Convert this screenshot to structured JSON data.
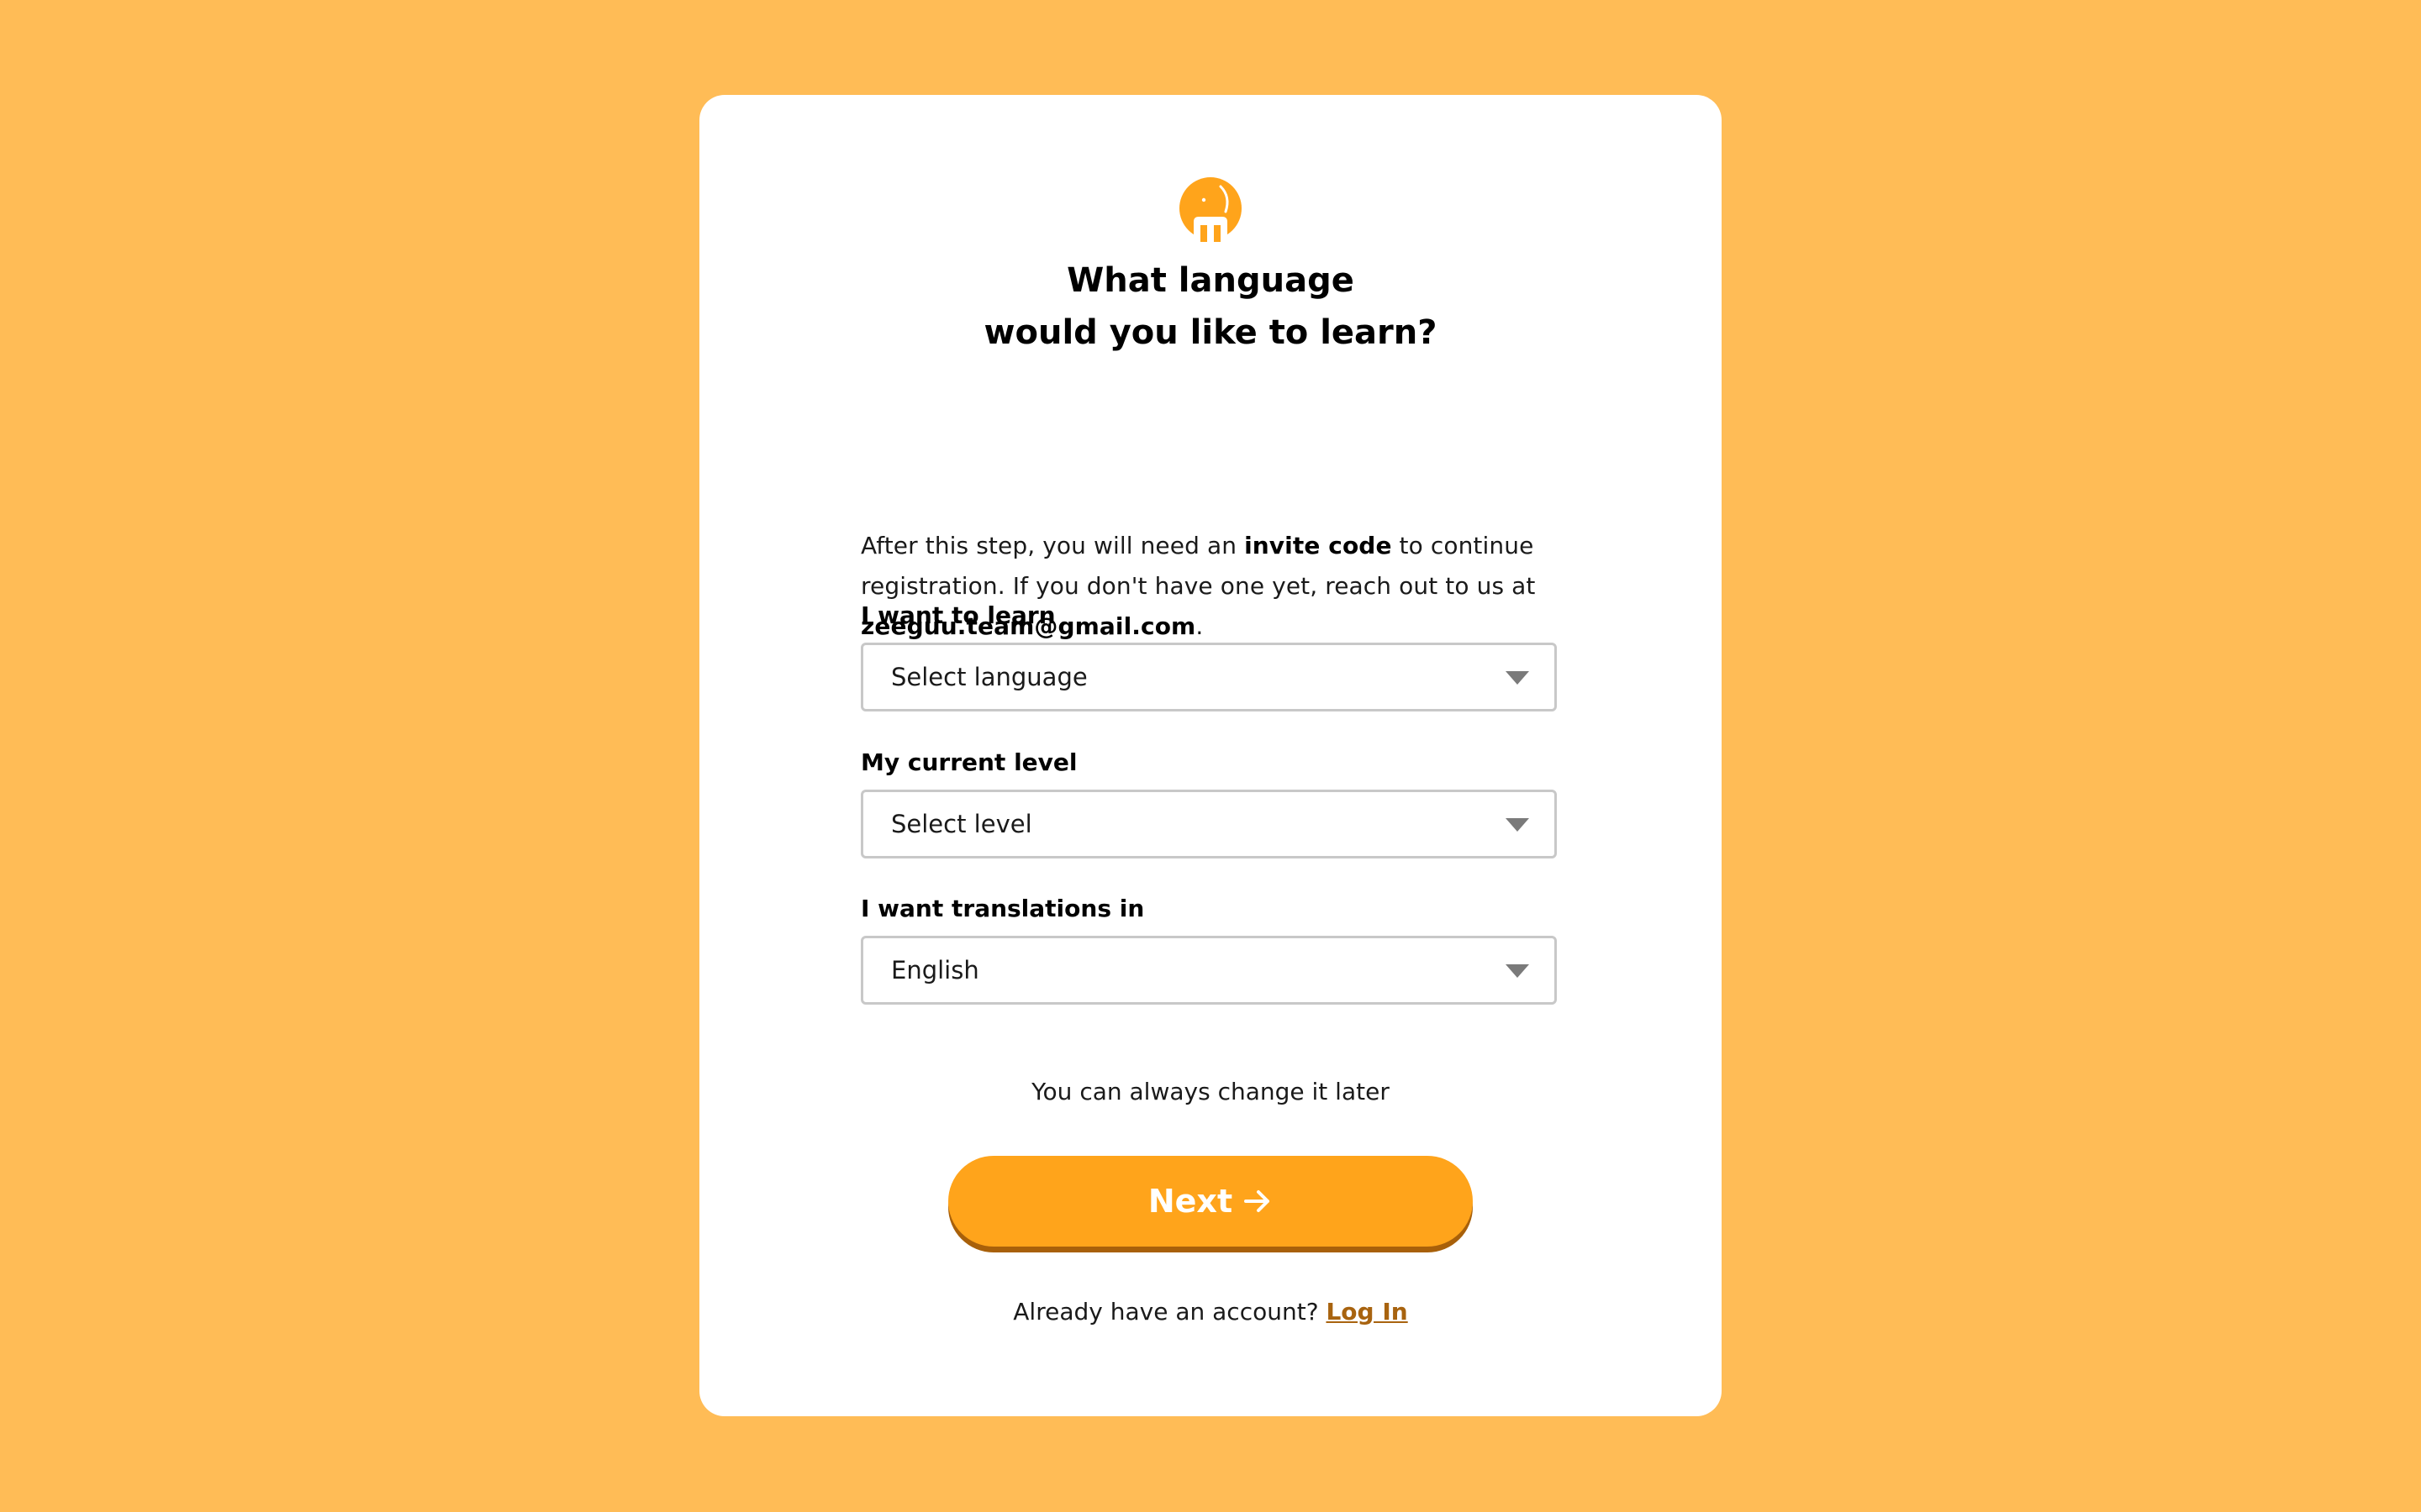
{
  "colors": {
    "background": "#FFBC56",
    "accent": "#FFA41B",
    "accent_shadow": "#A8600A",
    "link": "#A8630F"
  },
  "logo": {
    "icon": "elephant-icon"
  },
  "heading": {
    "line1": "What language",
    "line2": "would you like to learn?"
  },
  "intro": {
    "part1": "After this step, you will need an ",
    "bold1": "invite code",
    "part2": " to continue registration. If you don't have one yet, reach out to us at ",
    "email": "zeeguu.team@gmail.com",
    "part3": "."
  },
  "form": {
    "learn_label": "I want to learn",
    "learn_value": "Select language",
    "level_label": "My current level",
    "level_value": "Select level",
    "translation_label": "I want translations in",
    "translation_value": "English"
  },
  "hint": "You can always change it later",
  "next_button": {
    "label": "Next",
    "icon": "arrow-right-icon"
  },
  "footer": {
    "text": "Already have an account? ",
    "link": "Log In"
  }
}
